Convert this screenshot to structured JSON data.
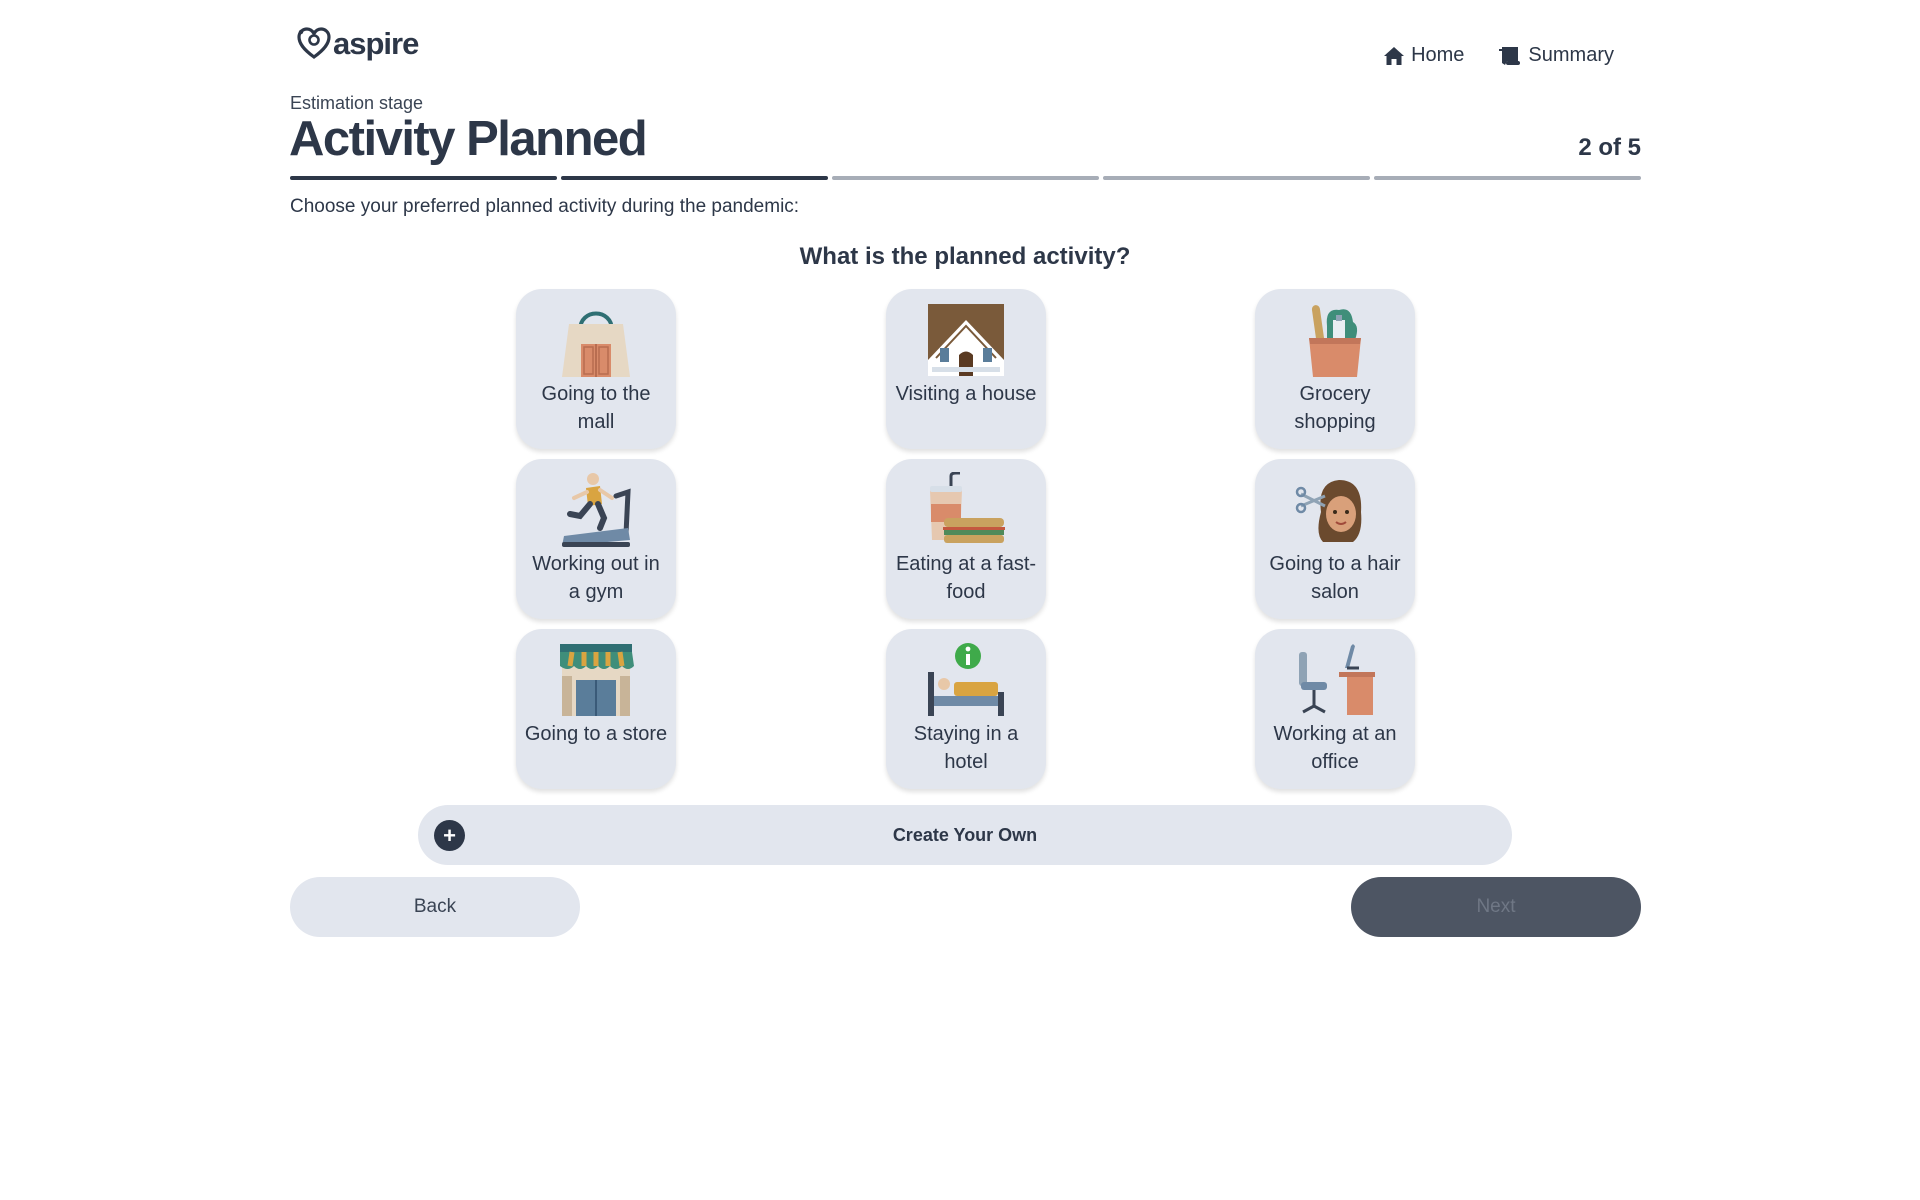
{
  "brand": {
    "name": "aspire"
  },
  "nav": {
    "home": "Home",
    "summary": "Summary"
  },
  "header": {
    "stage": "Estimation stage",
    "title": "Activity Planned",
    "step": "2 of 5",
    "progress": {
      "current_step": 2,
      "total_steps": 5
    }
  },
  "instruction": "Choose your preferred planned activity during the pandemic:",
  "question": "What is the planned activity?",
  "activities": [
    {
      "icon": "shopping-bag-icon",
      "label": "Going to the mall"
    },
    {
      "icon": "house-icon",
      "label": "Visiting a house"
    },
    {
      "icon": "grocery-bag-icon",
      "label": "Grocery shopping"
    },
    {
      "icon": "treadmill-icon",
      "label": "Working out in a gym"
    },
    {
      "icon": "fast-food-icon",
      "label": "Eating at a fast-food"
    },
    {
      "icon": "hair-salon-icon",
      "label": "Going to a hair salon"
    },
    {
      "icon": "storefront-icon",
      "label": "Going to a store"
    },
    {
      "icon": "hotel-bed-icon",
      "label": "Staying in a hotel"
    },
    {
      "icon": "office-desk-icon",
      "label": "Working at an office"
    }
  ],
  "create_own": {
    "label": "Create Your Own",
    "icon": "plus-circle-icon"
  },
  "buttons": {
    "back": "Back",
    "next": "Next"
  },
  "colors": {
    "primary": "#2d3748",
    "card_bg": "#e2e6ee",
    "next_disabled": "#4d5563"
  }
}
